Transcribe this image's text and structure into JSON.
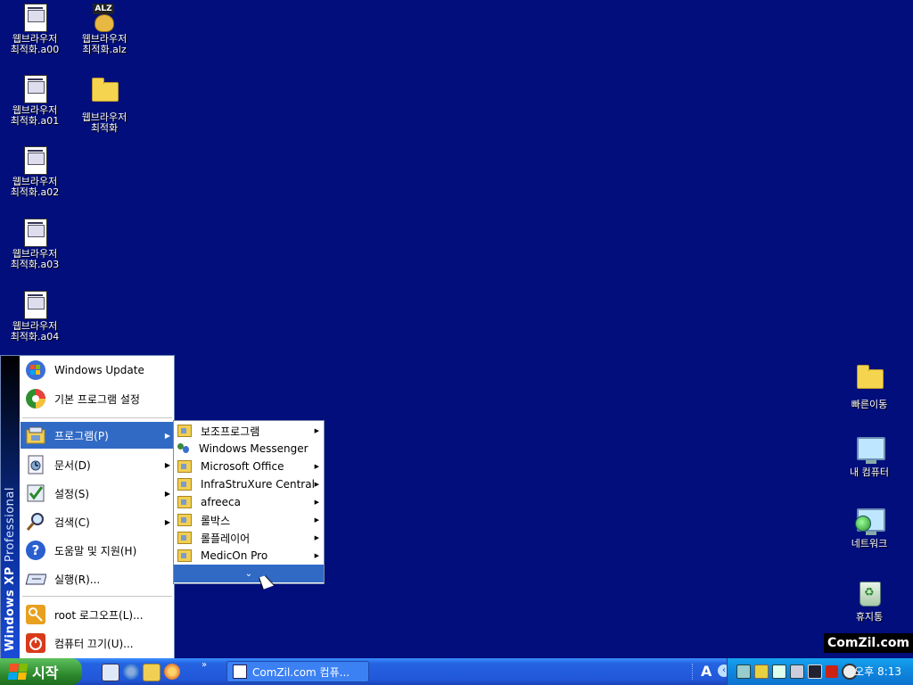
{
  "desktop": {
    "left_icons": [
      {
        "name": "file-a00-icon",
        "type": "file",
        "lines": [
          "웹브라우저",
          "최적화.a00"
        ]
      },
      {
        "name": "file-alz-icon",
        "type": "alz",
        "lines": [
          "웹브라우저",
          "최적화.alz"
        ],
        "badge": "ALZ"
      },
      {
        "name": "file-a01-icon",
        "type": "file",
        "lines": [
          "웹브라우저",
          "최적화.a01"
        ]
      },
      {
        "name": "folder-icon",
        "type": "folder",
        "lines": [
          "웹브라우저",
          "최적화"
        ]
      },
      {
        "name": "file-a02-icon",
        "type": "file",
        "lines": [
          "웹브라우저",
          "최적화.a02"
        ]
      },
      {
        "name": "file-a03-icon",
        "type": "file",
        "lines": [
          "웹브라우저",
          "최적화.a03"
        ]
      },
      {
        "name": "file-a04-icon",
        "type": "file",
        "lines": [
          "웹브라우저",
          "최적화.a04"
        ]
      }
    ],
    "right_icons": [
      {
        "name": "quick-move-folder-icon",
        "type": "folder",
        "label": "빠른이동"
      },
      {
        "name": "my-computer-icon",
        "type": "monitor",
        "label": "내 컴퓨터"
      },
      {
        "name": "network-icon",
        "type": "network",
        "label": "네트워크"
      },
      {
        "name": "recycle-bin-icon",
        "type": "bin",
        "label": "휴지통"
      }
    ],
    "watermark": "ComZil.com"
  },
  "start_menu": {
    "band_text_bold": "Windows XP",
    "band_text_light": "Professional",
    "items": [
      {
        "label": "Windows Update",
        "icon": "windows-update-icon",
        "has_arrow": false,
        "selected": false
      },
      {
        "label": "기본 프로그램 설정",
        "icon": "default-programs-icon",
        "has_arrow": false,
        "selected": false
      },
      {
        "label": "프로그램(P)",
        "icon": "programs-icon",
        "has_arrow": true,
        "selected": true
      },
      {
        "label": "문서(D)",
        "icon": "documents-icon",
        "has_arrow": true,
        "selected": false
      },
      {
        "label": "설정(S)",
        "icon": "settings-icon",
        "has_arrow": true,
        "selected": false
      },
      {
        "label": "검색(C)",
        "icon": "search-icon",
        "has_arrow": true,
        "selected": false
      },
      {
        "label": "도움말 및 지원(H)",
        "icon": "help-icon",
        "has_arrow": false,
        "selected": false
      },
      {
        "label": "실행(R)...",
        "icon": "run-icon",
        "has_arrow": false,
        "selected": false
      },
      {
        "label": "root 로그오프(L)...",
        "icon": "logoff-key-icon",
        "has_arrow": false,
        "selected": false
      },
      {
        "label": "컴퓨터 끄기(U)...",
        "icon": "power-icon",
        "has_arrow": false,
        "selected": false
      }
    ]
  },
  "programs_submenu": {
    "items": [
      {
        "label": "보조프로그램",
        "has_arrow": true
      },
      {
        "label": "Windows Messenger",
        "has_arrow": false,
        "icon": "messenger-icon"
      },
      {
        "label": "Microsoft Office",
        "has_arrow": true
      },
      {
        "label": "InfraStruXure Central",
        "has_arrow": true
      },
      {
        "label": "afreeca",
        "has_arrow": true
      },
      {
        "label": "롤박스",
        "has_arrow": true
      },
      {
        "label": "롤플레이어",
        "has_arrow": true
      },
      {
        "label": "MedicOn Pro",
        "has_arrow": true
      }
    ],
    "expand_glyph": "⌄"
  },
  "taskbar": {
    "start_label": "시작",
    "quick_launch": [
      "desktop-shortcut-icon",
      "internet-explorer-icon",
      "explorer-icon",
      "media-icon"
    ],
    "chevron": "»",
    "window_button": "ComZil.com 컴퓨...",
    "lang_indicator": "A",
    "tray_arrow": "‹",
    "clock": "오후 8:13",
    "colors": {
      "taskbar": "#2257d9",
      "start": "#2e8b2e",
      "tray": "#0f8be0",
      "selected": "#316ac5",
      "desktop": "#010e7c"
    }
  }
}
